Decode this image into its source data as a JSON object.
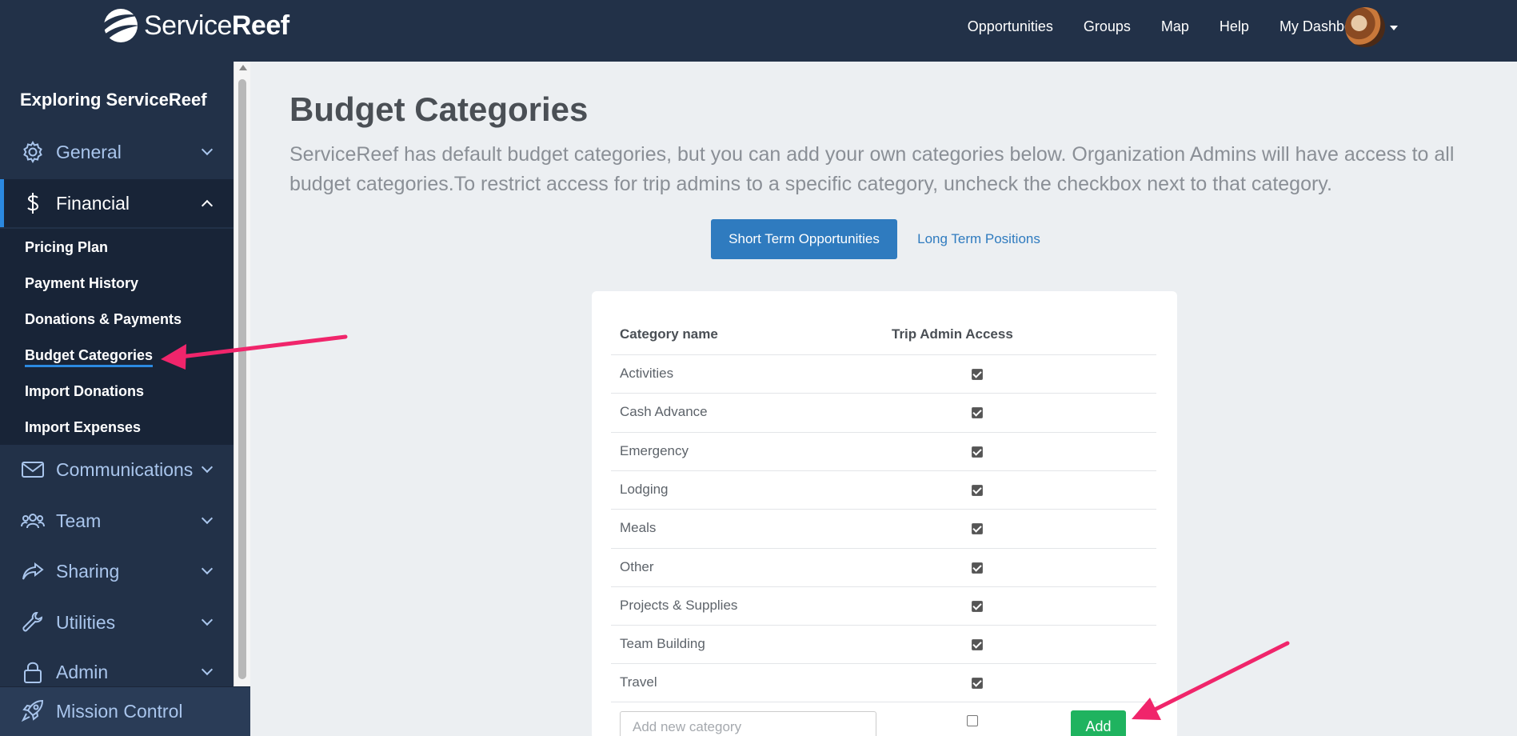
{
  "brand": {
    "name_light": "Service",
    "name_bold": "Reef"
  },
  "topnav": {
    "items": [
      "Opportunities",
      "Groups",
      "Map",
      "Help",
      "My Dashboard"
    ]
  },
  "sidebar": {
    "title": "Exploring ServiceReef",
    "items": [
      {
        "label": "General",
        "icon": "gear-icon"
      },
      {
        "label": "Financial",
        "icon": "dollar-icon",
        "expanded": true
      },
      {
        "label": "Communications",
        "icon": "envelope-icon"
      },
      {
        "label": "Team",
        "icon": "users-icon"
      },
      {
        "label": "Sharing",
        "icon": "share-icon"
      },
      {
        "label": "Utilities",
        "icon": "wrench-icon"
      },
      {
        "label": "Admin",
        "icon": "lock-icon"
      }
    ],
    "financial_sub": [
      "Pricing Plan",
      "Payment History",
      "Donations & Payments",
      "Budget Categories",
      "Import Donations",
      "Import Expenses"
    ],
    "active_sub": "Budget Categories",
    "mission_control": "Mission Control"
  },
  "main": {
    "title": "Budget Categories",
    "description": "ServiceReef has default budget categories, but you can add your own categories below. Organization Admins will have access to all budget categories.To restrict access for trip admins to a specific category, uncheck the checkbox next to that category.",
    "tabs": {
      "active": "Short Term Opportunities",
      "other": "Long Term Positions"
    },
    "table": {
      "headers": [
        "Category name",
        "Trip Admin Access"
      ],
      "rows": [
        {
          "name": "Activities",
          "access": true
        },
        {
          "name": "Cash Advance",
          "access": true
        },
        {
          "name": "Emergency",
          "access": true
        },
        {
          "name": "Lodging",
          "access": true
        },
        {
          "name": "Meals",
          "access": true
        },
        {
          "name": "Other",
          "access": true
        },
        {
          "name": "Projects & Supplies",
          "access": true
        },
        {
          "name": "Team Building",
          "access": true
        },
        {
          "name": "Travel",
          "access": true
        }
      ],
      "new_placeholder": "Add new category",
      "new_access": false,
      "add_label": "Add"
    }
  },
  "colors": {
    "nav_bg": "#223148",
    "accent": "#2b89e0",
    "add_green": "#1fb35f",
    "arrow": "#f0256b"
  }
}
